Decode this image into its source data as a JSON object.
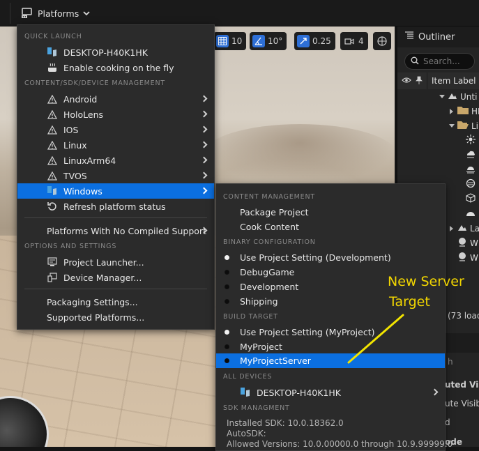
{
  "toolbar": {
    "platforms_label": "Platforms"
  },
  "viewport_tools": {
    "grid_value": "10",
    "angle_value": "10°",
    "scale_value": "0.25",
    "camera_value": "4"
  },
  "outliner": {
    "title": "Outliner",
    "search_placeholder": "Search...",
    "column_label": "Item Label",
    "rows": [
      "Unti",
      "HL",
      "Li",
      "La",
      "W",
      "W"
    ],
    "loaded_text": "(73 load",
    "filter_placeholder": "h",
    "details_rows": [
      "uted Visib",
      "ute Visibi",
      "d",
      "ode"
    ]
  },
  "platforms_menu": {
    "quick_launch_header": "QUICK LAUNCH",
    "quick_launch": [
      {
        "label": "DESKTOP-H40K1HK",
        "icon": "windows-pc-icon"
      },
      {
        "label": "Enable cooking on the fly",
        "icon": "cooking-pot-icon"
      }
    ],
    "device_mgmt_header": "CONTENT/SDK/DEVICE MANAGEMENT",
    "platforms": [
      {
        "label": "Android",
        "icon": "warning-icon"
      },
      {
        "label": "HoloLens",
        "icon": "warning-icon"
      },
      {
        "label": "IOS",
        "icon": "warning-icon"
      },
      {
        "label": "Linux",
        "icon": "warning-icon"
      },
      {
        "label": "LinuxArm64",
        "icon": "warning-icon"
      },
      {
        "label": "TVOS",
        "icon": "warning-icon"
      },
      {
        "label": "Windows",
        "icon": "windows-icon",
        "selected": true
      }
    ],
    "refresh_label": "Refresh platform status",
    "no_compiled_label": "Platforms With No Compiled Support",
    "options_header": "OPTIONS AND SETTINGS",
    "options": [
      {
        "label": "Project Launcher...",
        "icon": "launcher-icon"
      },
      {
        "label": "Device Manager...",
        "icon": "device-manager-icon"
      }
    ],
    "packaging_label": "Packaging Settings...",
    "supported_label": "Supported Platforms..."
  },
  "windows_submenu": {
    "content_header": "CONTENT MANAGEMENT",
    "content_items": [
      "Package Project",
      "Cook Content"
    ],
    "binary_header": "BINARY CONFIGURATION",
    "binary_items": [
      {
        "label": "Use Project Setting (Development)",
        "checked": true
      },
      {
        "label": "DebugGame",
        "checked": false
      },
      {
        "label": "Development",
        "checked": false
      },
      {
        "label": "Shipping",
        "checked": false
      }
    ],
    "build_header": "BUILD TARGET",
    "build_items": [
      {
        "label": "Use Project Setting (MyProject)",
        "checked": true
      },
      {
        "label": "MyProject",
        "checked": false
      },
      {
        "label": "MyProjectServer",
        "checked": false,
        "selected": true
      }
    ],
    "devices_header": "ALL DEVICES",
    "device_label": "DESKTOP-H40K1HK",
    "sdk_header": "SDK MANAGMENT",
    "sdk_lines": [
      "Installed SDK: 10.0.18362.0",
      "AutoSDK:",
      "Allowed Versions: 10.0.00000.0 through 10.9.99999.0"
    ]
  },
  "annotation": {
    "line1": "New Server",
    "line2": "Target",
    "color": "#f2d600"
  },
  "colors": {
    "accent": "#0b6fe0",
    "menu_bg": "#2b2b2b",
    "toolbar_bg": "#1a1a1a"
  }
}
